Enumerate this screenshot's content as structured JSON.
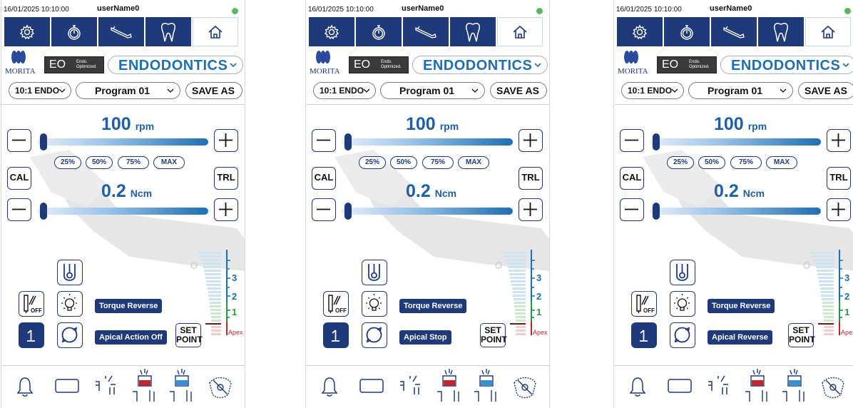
{
  "screens": [
    {
      "status_bar": {
        "datetime": "16/01/2025 10:10:00",
        "user": "userName0"
      },
      "brand": {
        "morita": "MORITA",
        "eo_mark": "EO",
        "eo_sub1": "Endo.",
        "eo_sub2": "Optimized.",
        "mode": "ENDODONTICS"
      },
      "program_bar": {
        "ratio": "10:1 ENDO",
        "program": "Program 01",
        "save_as": "SAVE AS"
      },
      "speed": {
        "value": "100",
        "unit": "rpm",
        "level": 0.0
      },
      "presets": [
        "25%",
        "50%",
        "75%",
        "MAX"
      ],
      "side_buttons": {
        "cal": "CAL",
        "trl": "TRL"
      },
      "torque": {
        "value": "0.2",
        "unit": "Ncm",
        "level": 0.0
      },
      "functions": {
        "torque_label": "Torque Reverse",
        "apical_label": "Apical Action Off",
        "set_point": [
          "SET",
          "POINT"
        ]
      },
      "scale": {
        "ticks": [
          "3",
          "2",
          "1"
        ],
        "apex": "Apex"
      }
    },
    {
      "status_bar": {
        "datetime": "16/01/2025 10:10:00",
        "user": "userName0"
      },
      "brand": {
        "morita": "MORITA",
        "eo_mark": "EO",
        "eo_sub1": "Endo.",
        "eo_sub2": "Optimized.",
        "mode": "ENDODONTICS"
      },
      "program_bar": {
        "ratio": "10:1 ENDO",
        "program": "Program 01",
        "save_as": "SAVE AS"
      },
      "speed": {
        "value": "100",
        "unit": "rpm",
        "level": 0.0
      },
      "presets": [
        "25%",
        "50%",
        "75%",
        "MAX"
      ],
      "side_buttons": {
        "cal": "CAL",
        "trl": "TRL"
      },
      "torque": {
        "value": "0.2",
        "unit": "Ncm",
        "level": 0.0
      },
      "functions": {
        "torque_label": "Torque Reverse",
        "apical_label": "Apical Stop",
        "set_point": [
          "SET",
          "POINT"
        ]
      },
      "scale": {
        "ticks": [
          "3",
          "2",
          "1"
        ],
        "apex": "Apex"
      }
    },
    {
      "status_bar": {
        "datetime": "16/01/2025 10:10:00",
        "user": "userName0"
      },
      "brand": {
        "morita": "MORITA",
        "eo_mark": "EO",
        "eo_sub1": "Endo.",
        "eo_sub2": "Optimized.",
        "mode": "ENDODONTICS"
      },
      "program_bar": {
        "ratio": "10:1 ENDO",
        "program": "Program 01",
        "save_as": "SAVE AS"
      },
      "speed": {
        "value": "100",
        "unit": "rpm",
        "level": 0.0
      },
      "presets": [
        "25%",
        "50%",
        "75%",
        "MAX"
      ],
      "side_buttons": {
        "cal": "CAL",
        "trl": "TRL"
      },
      "torque": {
        "value": "0.2",
        "unit": "Ncm",
        "level": 0.0
      },
      "functions": {
        "torque_label": "Torque Reverse",
        "apical_label": "Apical Reverse",
        "set_point": [
          "SET",
          "POINT"
        ]
      },
      "scale": {
        "ticks": [
          "3",
          "2",
          "1"
        ],
        "apex": "Apex"
      }
    }
  ],
  "colors": {
    "navy": "#1e3a7a",
    "accent_blue": "#1f6fb0",
    "status_green": "#5cb85c",
    "apex_red": "#c0272d"
  },
  "icons": {
    "toolbar": [
      "gear-icon",
      "stopwatch-icon",
      "handpiece-icon",
      "tooth-icon",
      "home-icon"
    ],
    "bottom": [
      "bell-icon",
      "rectangle-icon",
      "file-holder-icon",
      "red-irrigation-icon",
      "blue-irrigation-icon",
      "light-off-icon"
    ]
  }
}
